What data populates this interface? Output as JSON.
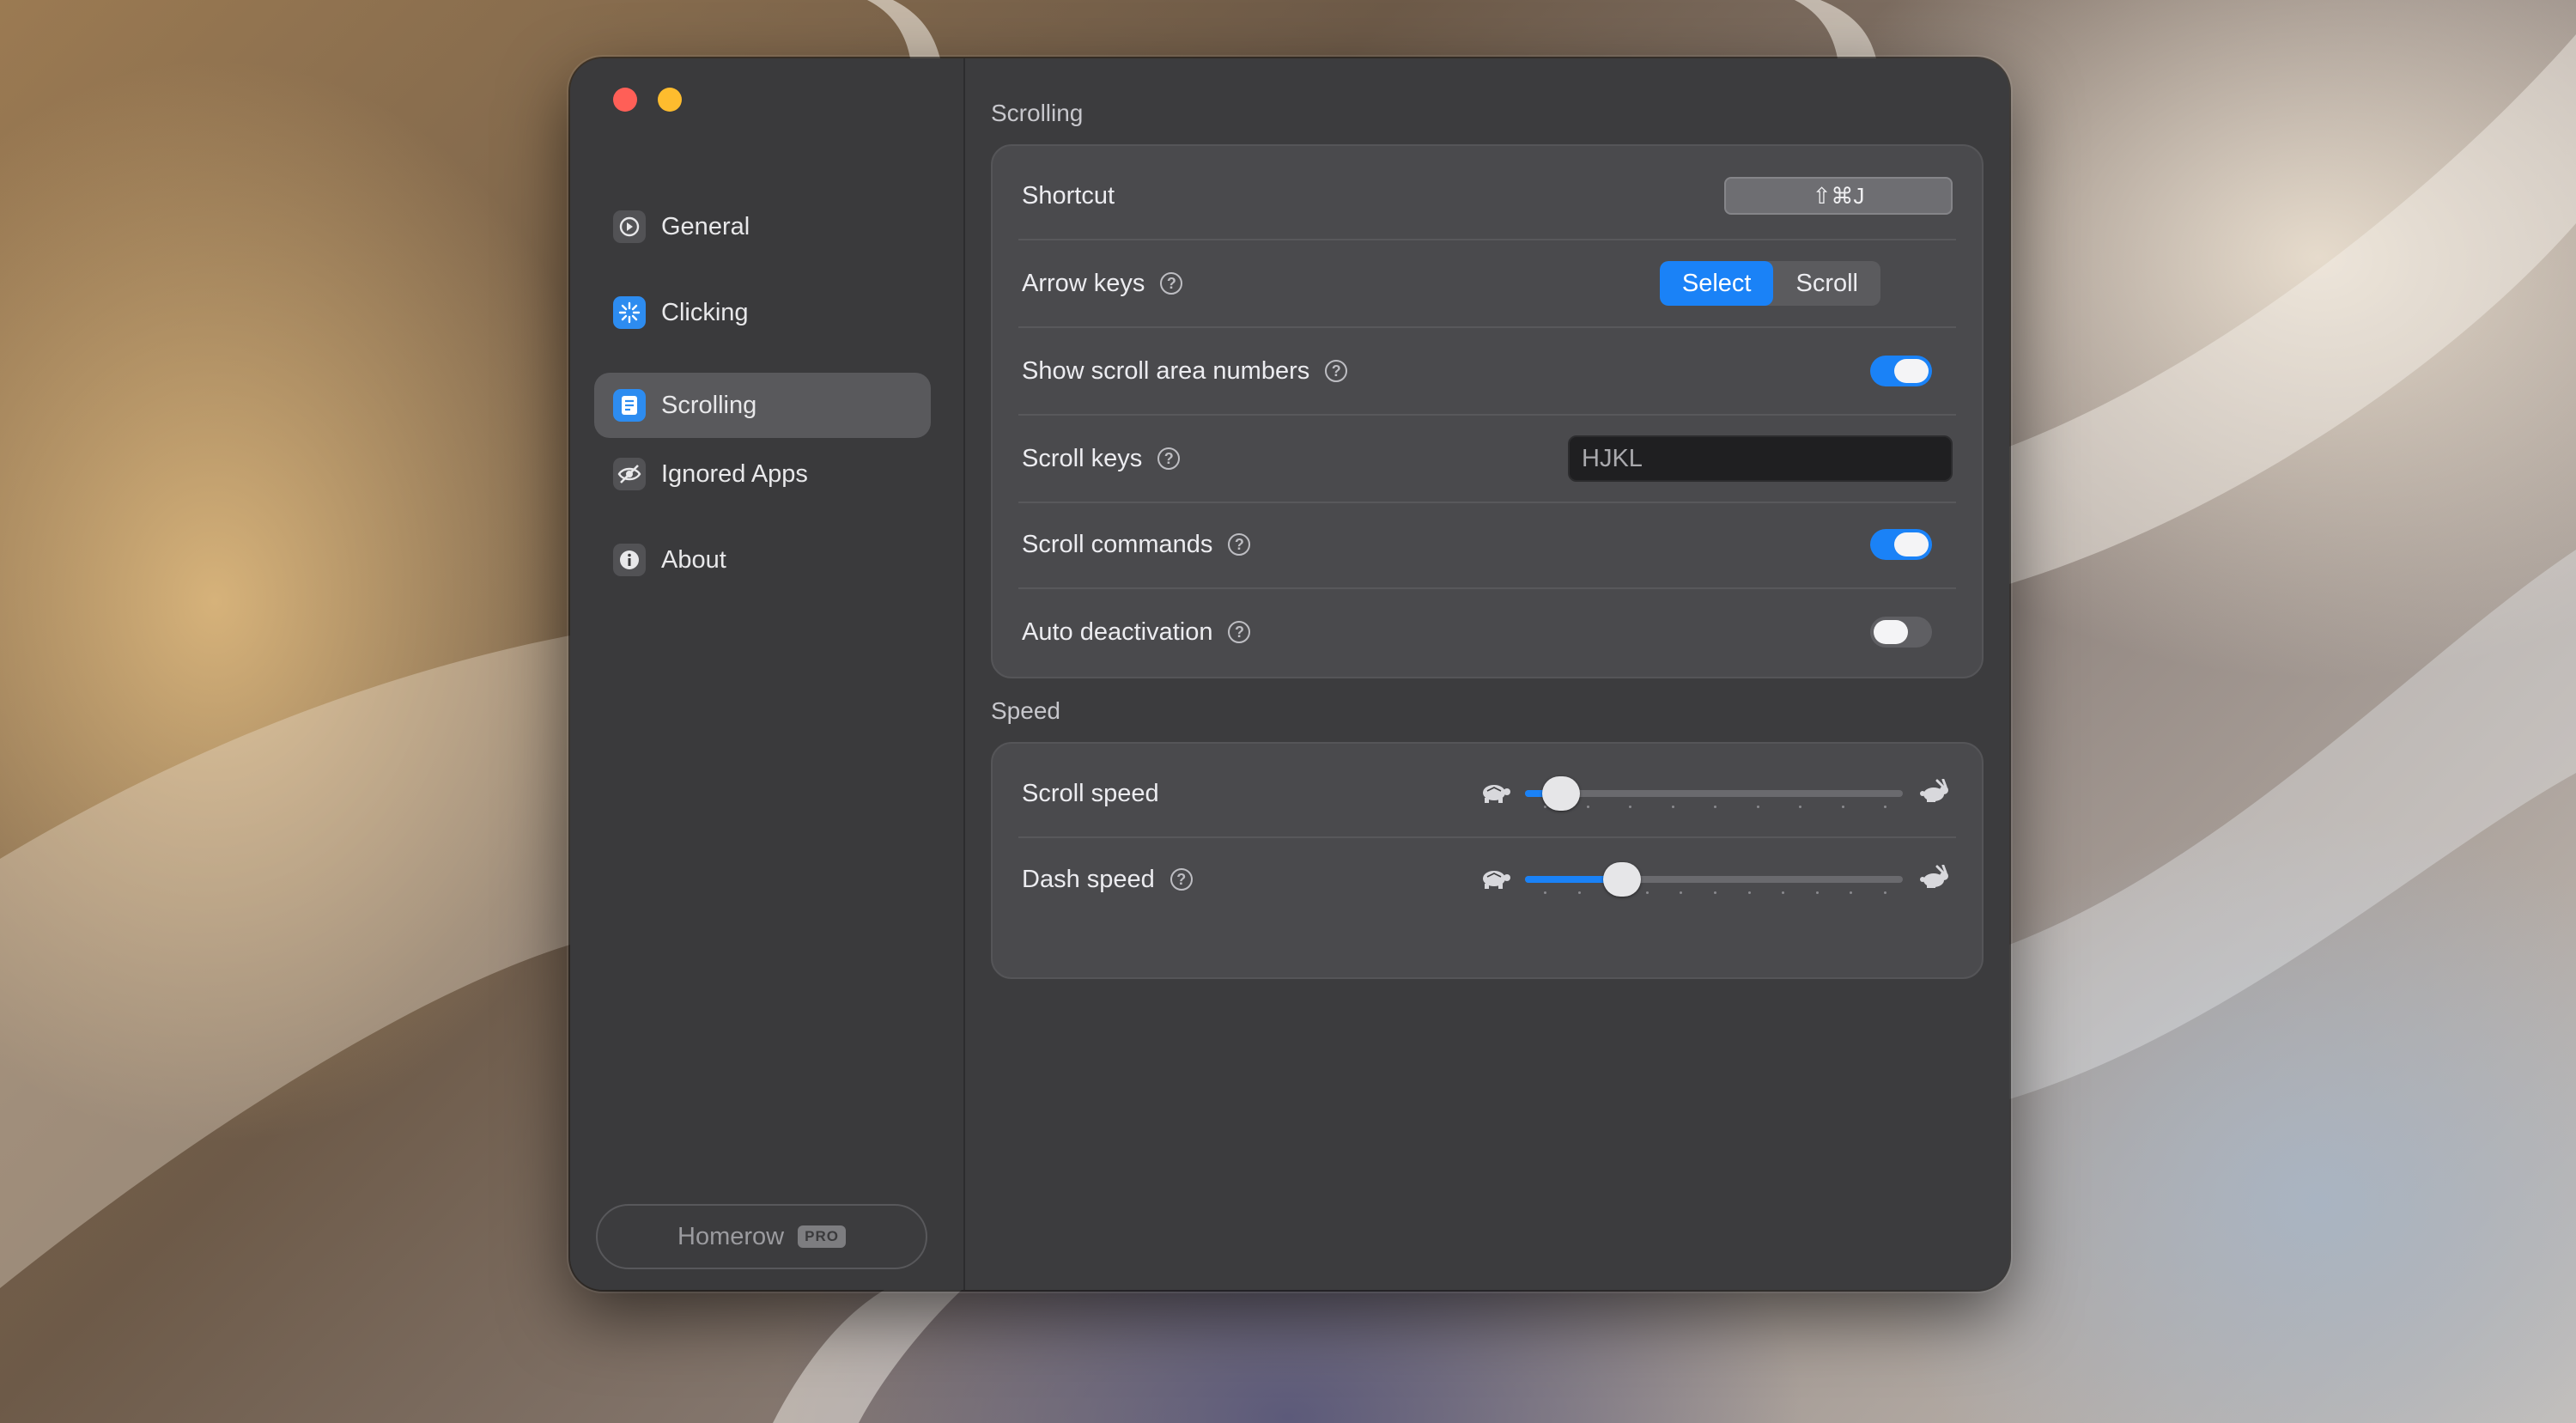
{
  "app": {
    "window_title": "Scrolling",
    "colors": {
      "accent": "#1a82f7",
      "close": "#ff5f57",
      "minimize": "#febc2e"
    }
  },
  "sidebar": {
    "items": [
      {
        "label": "General",
        "icon": "general-icon",
        "active": false
      },
      {
        "label": "Clicking",
        "icon": "clicking-icon",
        "active": false
      },
      {
        "label": "Scrolling",
        "icon": "scrolling-icon",
        "active": true
      },
      {
        "label": "Ignored Apps",
        "icon": "eye-slash-icon",
        "active": false
      },
      {
        "label": "About",
        "icon": "info-icon",
        "active": false
      }
    ],
    "footer": {
      "label": "Homerow",
      "badge": "PRO"
    }
  },
  "scrolling": {
    "title": "Scrolling",
    "shortcut": {
      "label": "Shortcut",
      "value": "⇧⌘J"
    },
    "arrow_keys": {
      "label": "Arrow keys",
      "options": [
        "Select",
        "Scroll"
      ],
      "selected": "Select"
    },
    "show_numbers": {
      "label": "Show scroll area numbers",
      "on": true
    },
    "scroll_keys": {
      "label": "Scroll keys",
      "value": "HJKL"
    },
    "scroll_commands": {
      "label": "Scroll commands",
      "on": true
    },
    "auto_deactivation": {
      "label": "Auto deactivation",
      "on": false
    }
  },
  "speed": {
    "title": "Speed",
    "scroll_speed": {
      "label": "Scroll speed",
      "level": 0.05,
      "steps": 9
    },
    "dash_speed": {
      "label": "Dash speed",
      "level": 0.23,
      "steps": 11
    }
  }
}
